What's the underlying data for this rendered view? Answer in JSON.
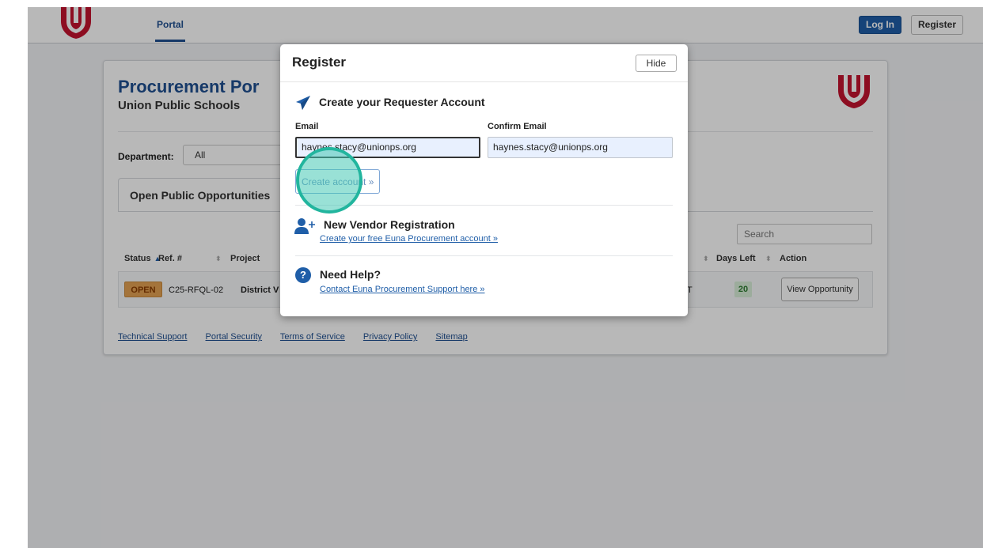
{
  "nav": {
    "portal_label": "Portal",
    "login_label": "Log In",
    "register_label": "Register"
  },
  "page": {
    "title": "Procurement Por",
    "subtitle": "Union Public Schools",
    "department_label": "Department:",
    "department_value": "All",
    "tab_label": "Open Public Opportunities",
    "search_placeholder": "Search"
  },
  "table": {
    "headers": {
      "status": "Status",
      "ref": "Ref. #",
      "project": "Project",
      "days_left": "Days Left",
      "action": "Action"
    },
    "row": {
      "status": "OPEN",
      "ref": "C25-RFQL-02",
      "project": "District V",
      "date_fragment": "T",
      "days_left": "20",
      "action_label": "View Opportunity"
    }
  },
  "footer": {
    "links": [
      "Technical Support",
      "Portal Security",
      "Terms of Service",
      "Privacy Policy",
      "Sitemap"
    ]
  },
  "modal": {
    "title": "Register",
    "hide_label": "Hide",
    "requester": {
      "heading": "Create your Requester Account",
      "email_label": "Email",
      "email_value": "haynes.stacy@unionps.org",
      "confirm_label": "Confirm Email",
      "confirm_value": "haynes.stacy@unionps.org",
      "create_label": "Create account »"
    },
    "vendor": {
      "heading": "New Vendor Registration",
      "link": "Create your free Euna Procurement account »"
    },
    "help": {
      "heading": "Need Help?",
      "link": "Contact Euna Procurement Support here »",
      "icon_glyph": "?"
    }
  },
  "colors": {
    "brand_blue": "#1f4f91",
    "brand_red": "#c4122f",
    "click_highlight": "#22b59e"
  }
}
